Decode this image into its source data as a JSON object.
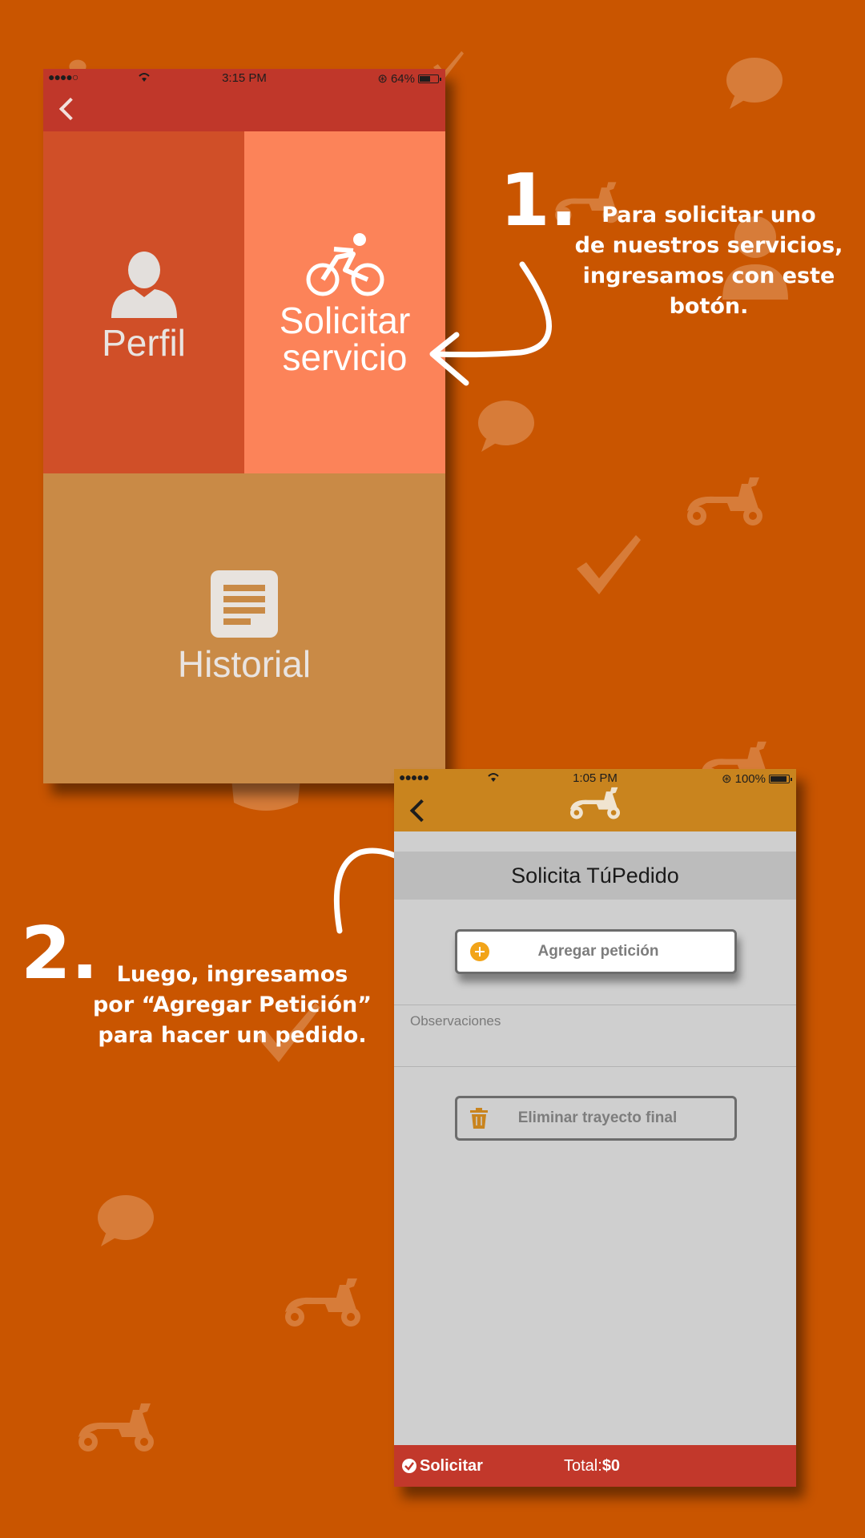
{
  "colors": {
    "background": "#c95500",
    "screen1_header": "#c0372a",
    "tile_perfil": "#d04f28",
    "tile_solicitar": "#fc8359",
    "tile_historial": "#c98a46",
    "screen2_header": "#c9841e",
    "screen2_footer": "#c2382b",
    "add_icon": "#f2a419",
    "trash_icon": "#c9841e"
  },
  "screen1": {
    "status": {
      "time": "3:15 PM",
      "battery": "64%",
      "battery_level": 0.64
    },
    "tiles": {
      "perfil": {
        "label": "Perfil",
        "icon": "person-icon"
      },
      "solicitar": {
        "label_line1": "Solicitar",
        "label_line2": "servicio",
        "icon": "bicycle-icon"
      },
      "historial": {
        "label": "Historial",
        "icon": "document-icon"
      }
    }
  },
  "annotation1": {
    "number": "1.",
    "line1": "Para solicitar uno",
    "line2": "de nuestros servicios,",
    "line3": "ingresamos con  este",
    "line4": "botón."
  },
  "annotation2": {
    "number": "2.",
    "line1": "Luego, ingresamos",
    "line2": "por “Agregar Petición”",
    "line3": "para hacer un pedido."
  },
  "screen2": {
    "status": {
      "time": "1:05 PM",
      "battery": "100%",
      "battery_level": 1.0
    },
    "title": "Solicita TúPedido",
    "add_button": "Agregar petición",
    "observations_label": "Observaciones",
    "delete_button": "Eliminar trayecto final",
    "footer": {
      "solicitar": "Solicitar",
      "total": "Total:$0"
    }
  }
}
